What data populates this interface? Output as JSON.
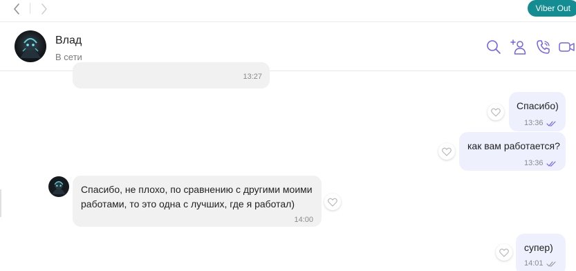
{
  "topbar": {
    "back_icon": "chevron-left-icon",
    "forward_icon": "chevron-right-icon",
    "viber_out_label": "Viber Out"
  },
  "contact": {
    "name": "Влад",
    "status": "В сети"
  },
  "header_icons": [
    "search-icon",
    "add-participant-icon",
    "call-icon",
    "video-call-icon"
  ],
  "accent_color": "#7360f2",
  "messages": [
    {
      "direction": "incoming",
      "time": "13:27"
    },
    {
      "direction": "outgoing",
      "text": "Спасибо)",
      "time": "13:36",
      "status": "read"
    },
    {
      "direction": "outgoing",
      "text": "как вам работается?",
      "time": "13:36",
      "status": "read"
    },
    {
      "direction": "incoming",
      "lines": [
        "Спасибо, не плохо, по сравнению с другими моими",
        "работами, то это одна с лучших, где я работал)"
      ],
      "time": "14:00"
    },
    {
      "direction": "outgoing",
      "text": "супер)",
      "time": "14:01",
      "status": "delivered"
    }
  ]
}
